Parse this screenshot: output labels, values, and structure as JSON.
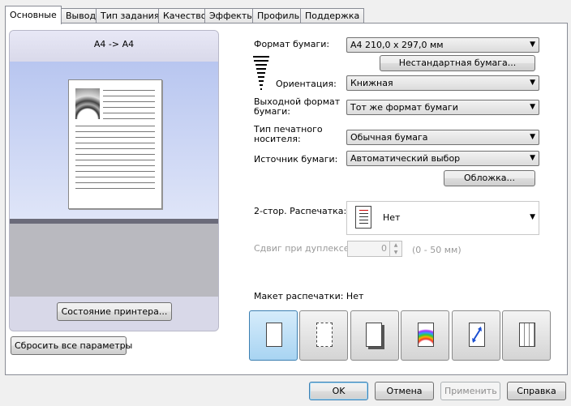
{
  "tabs": [
    {
      "label": "Основные"
    },
    {
      "label": "Вывод"
    },
    {
      "label": "Тип задания"
    },
    {
      "label": "Качество"
    },
    {
      "label": "Эффекты"
    },
    {
      "label": "Профиль"
    },
    {
      "label": "Поддержка"
    }
  ],
  "preview": {
    "caption": "A4 -> A4",
    "status_button": "Состояние принтера..."
  },
  "reset_button": "Сбросить все параметры",
  "paper": {
    "format_label": "Формат бумаги:",
    "format_value": "A4   210,0 x 297,0 мм",
    "custom_button": "Нестандартная бумага...",
    "orientation_label": "Ориентация:",
    "orientation_value": "Книжная",
    "output_label_line1": "Выходной формат",
    "output_label_line2": "бумаги:",
    "output_value": "Тот же формат бумаги",
    "media_label_line1": "Тип печатного",
    "media_label_line2": "носителя:",
    "media_value": "Обычная бумага",
    "source_label": "Источник бумаги:",
    "source_value": "Автоматический выбор",
    "cover_button": "Обложка..."
  },
  "duplex": {
    "label": "2-стор. Распечатка:",
    "value": "Нет",
    "shift_label": "Сдвиг при дуплексе:",
    "shift_value": "0",
    "shift_range": "(0 - 50 мм)"
  },
  "layout": {
    "label": "Макет распечатки: Нет"
  },
  "footer": {
    "ok": "OK",
    "cancel": "Отмена",
    "apply": "Применить",
    "help": "Справка"
  }
}
